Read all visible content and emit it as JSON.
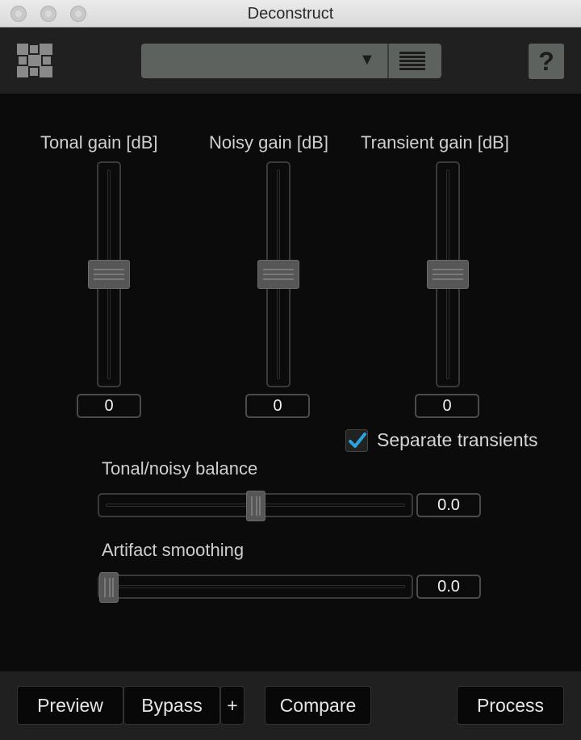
{
  "window": {
    "title": "Deconstruct"
  },
  "toolbar": {
    "logo_icon": "puzzle-logo-icon",
    "preset_value": "",
    "dropdown_icon": "triangle-down-icon",
    "preset_menu_icon": "list-menu-icon",
    "help_label": "?"
  },
  "gains": [
    {
      "label": "Tonal gain [dB]",
      "value": "0",
      "level": 0.5
    },
    {
      "label": "Noisy gain [dB]",
      "value": "0",
      "level": 0.5
    },
    {
      "label": "Transient gain [dB]",
      "value": "0",
      "level": 0.5
    }
  ],
  "separate_transients": {
    "label": "Separate transients",
    "checked": true
  },
  "balance": {
    "label": "Tonal/noisy balance",
    "value": "0.0",
    "position": 0.5
  },
  "smoothing": {
    "label": "Artifact smoothing",
    "value": "0.0",
    "position": 0.0
  },
  "footer": {
    "preview": "Preview",
    "bypass": "Bypass",
    "plus": "+",
    "compare": "Compare",
    "process": "Process"
  },
  "colors": {
    "panel": "#0b0b0b",
    "bar": "#202020",
    "accent": "#2aa4e0",
    "control": "#5d625e"
  }
}
